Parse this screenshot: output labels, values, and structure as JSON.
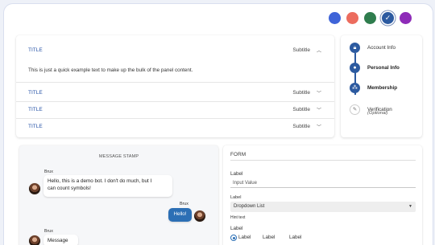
{
  "theme": {
    "swatches": [
      {
        "name": "blue",
        "color": "#3f64d8"
      },
      {
        "name": "coral",
        "color": "#ec6c5e"
      },
      {
        "name": "green",
        "color": "#2f7d4e"
      },
      {
        "name": "navy-selected",
        "color": "#2c5aa0"
      },
      {
        "name": "purple",
        "color": "#8e2bb8"
      }
    ],
    "selected_index": 3
  },
  "accordion": {
    "panels": [
      {
        "title": "TITLE",
        "subtitle": "Subtitle",
        "expanded": true,
        "body": "This is just a quick example text to make up the bulk of the panel content."
      },
      {
        "title": "TITLE",
        "subtitle": "Subtitle",
        "expanded": false
      },
      {
        "title": "TITLE",
        "subtitle": "Subtitle",
        "expanded": false
      },
      {
        "title": "TITLE",
        "subtitle": "Subtitle",
        "expanded": false
      }
    ]
  },
  "stepper": {
    "steps": [
      {
        "label": "Account Info",
        "icon": "lock-icon",
        "state": "complete"
      },
      {
        "label": "Personal Info",
        "icon": "person-icon",
        "state": "active"
      },
      {
        "label": "Membership",
        "icon": "groups-icon",
        "state": "active"
      },
      {
        "label": "Verification",
        "optional": "(Optional)",
        "icon": "edit-document-icon",
        "state": "inactive"
      }
    ]
  },
  "chat": {
    "stamp": "MESSAGE STAMP",
    "messages": [
      {
        "sender": "Brux",
        "text_line1": "Hello, this is a demo bot. I don't do much, but I",
        "text_line2": "can count symbols!",
        "from_me": false
      },
      {
        "sender": "Brux",
        "text": "Hello!",
        "from_me": true
      },
      {
        "sender": "Brux",
        "text": "Message",
        "from_me": false
      }
    ]
  },
  "form": {
    "title": "FORM",
    "input_label": "Label",
    "input_value": "Input Value",
    "dropdown_label": "Label",
    "dropdown_value": "Dropdown List",
    "dropdown_help": "Hint text",
    "radio_group_label": "Label",
    "radio_options": [
      "Label",
      "Label",
      "Label"
    ],
    "radio_selected": 0
  }
}
